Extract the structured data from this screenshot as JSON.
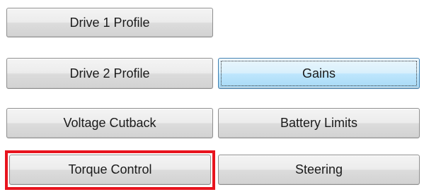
{
  "buttons": {
    "drive1_profile": "Drive 1 Profile",
    "drive2_profile": "Drive 2 Profile",
    "gains": "Gains",
    "voltage_cutback": "Voltage Cutback",
    "battery_limits": "Battery Limits",
    "torque_control": "Torque Control",
    "steering": "Steering"
  },
  "state": {
    "focused_button": "gains",
    "highlighted_button": "torque_control"
  },
  "colors": {
    "highlight_border": "#e8141e",
    "focused_border": "#3c7fb1",
    "button_face": "#e6e6e6"
  }
}
